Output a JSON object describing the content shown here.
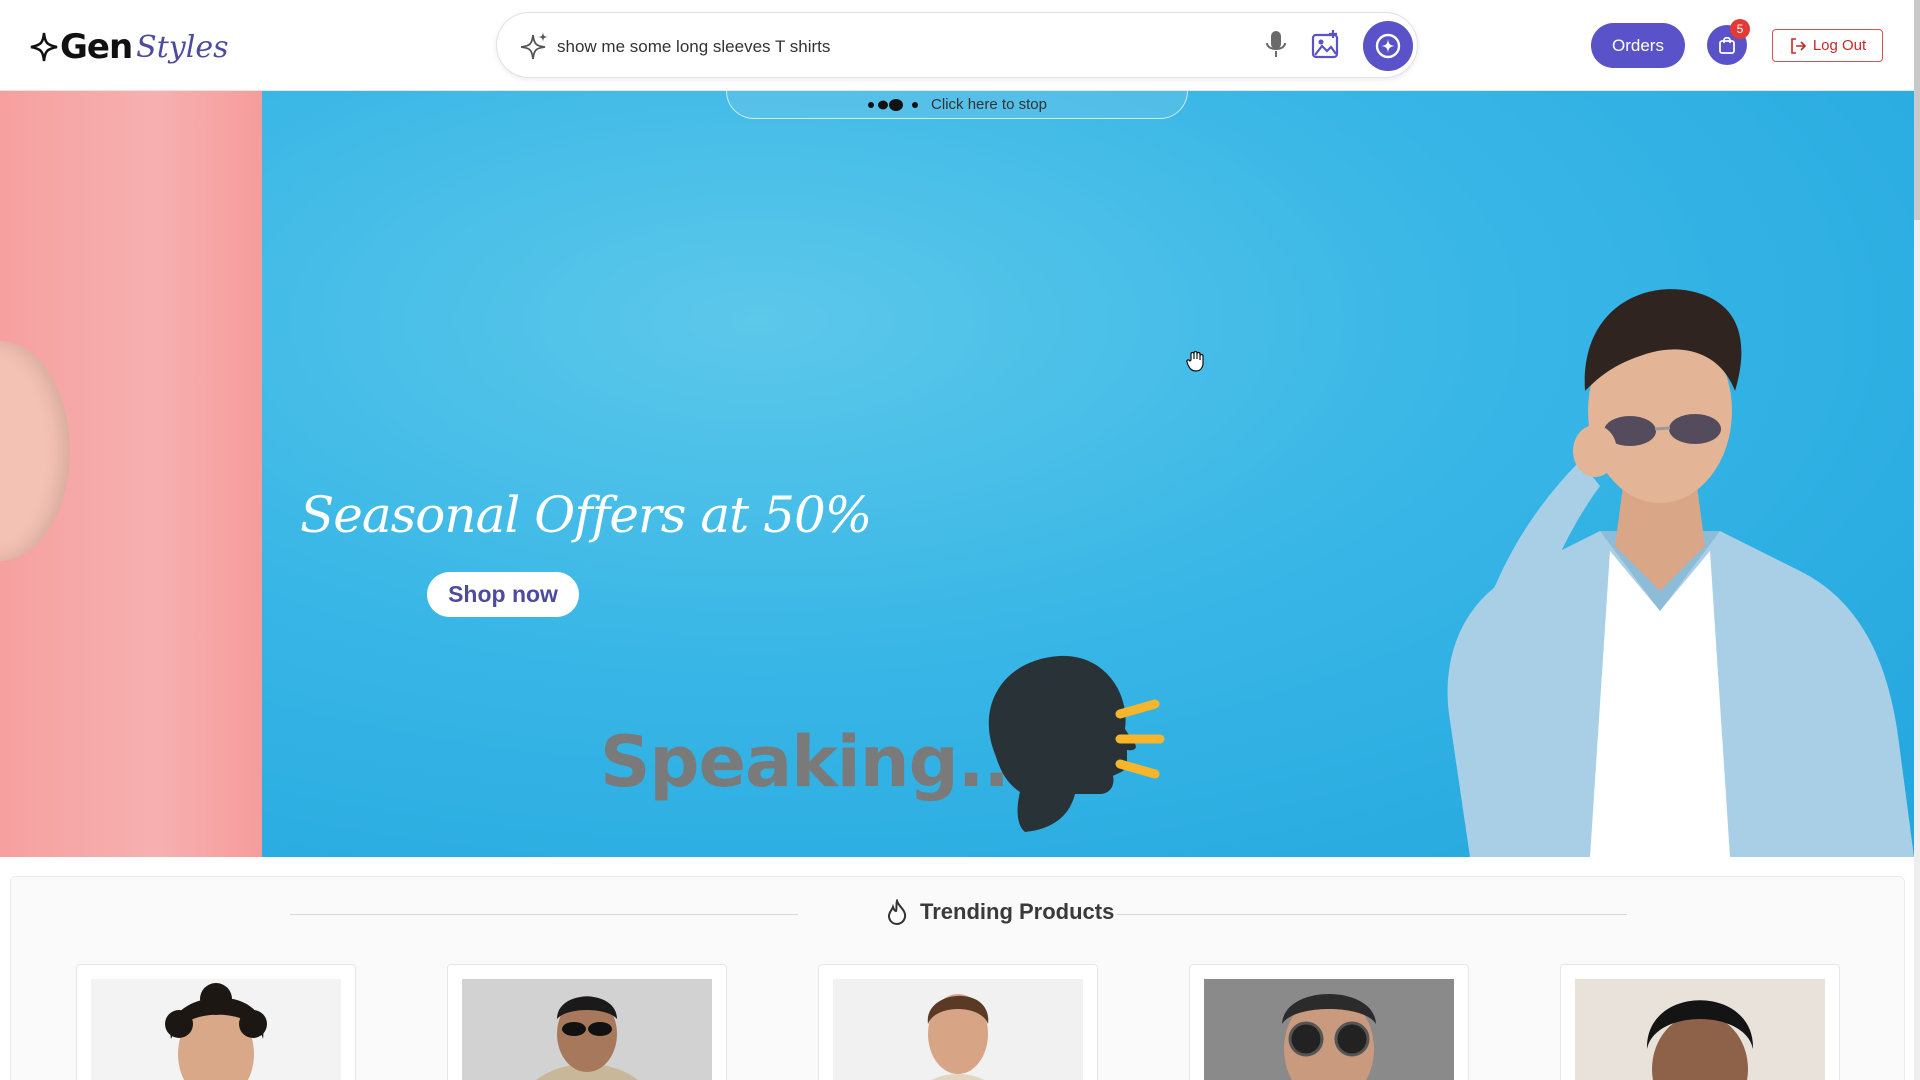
{
  "brand": {
    "name_bold": "Gen",
    "name_script": "Styles"
  },
  "search": {
    "query": "show me some long sleeves T shirts"
  },
  "voice": {
    "stop_label": "Click here to stop",
    "status": "Speaking..."
  },
  "nav": {
    "orders_label": "Orders",
    "cart_count": "5",
    "logout_label": "Log Out"
  },
  "hero": {
    "offer_text": "Seasonal Offers at 50%",
    "shop_label": "Shop now"
  },
  "trending": {
    "title": "Trending Products",
    "product_count": 5
  },
  "colors": {
    "primary": "#5a52c8",
    "hero_blue": "#2aaae2",
    "hero_pink": "#f7a9a9",
    "accent_yellow": "#f6b52a",
    "danger": "#d9534f"
  }
}
